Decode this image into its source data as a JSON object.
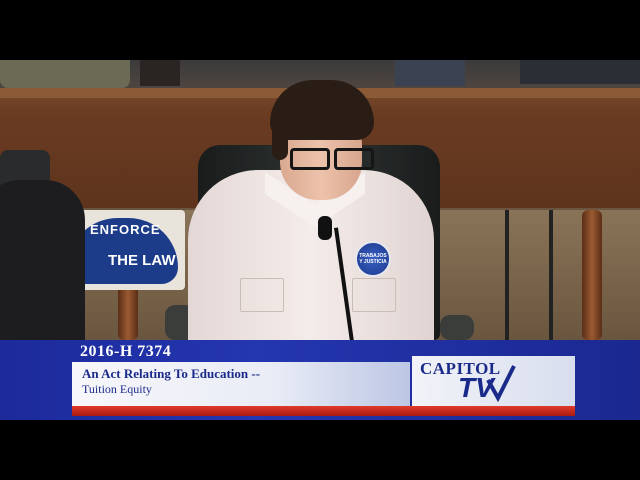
{
  "lower_third": {
    "bill_number": "2016-H 7374",
    "title": "An Act Relating To Education --",
    "subtitle": "Tuition Equity",
    "logo_word": "CAPITOL",
    "logo_tv": "TV"
  },
  "scene": {
    "sign_text_top": "ENFORCE",
    "sign_text_bottom": "THE LAW",
    "badge_text": "TRABAJOS Y JUSTICIA"
  },
  "colors": {
    "banner_blue": "#2436b0",
    "banner_red": "#e23a2a",
    "text_navy": "#1a2a8a"
  }
}
